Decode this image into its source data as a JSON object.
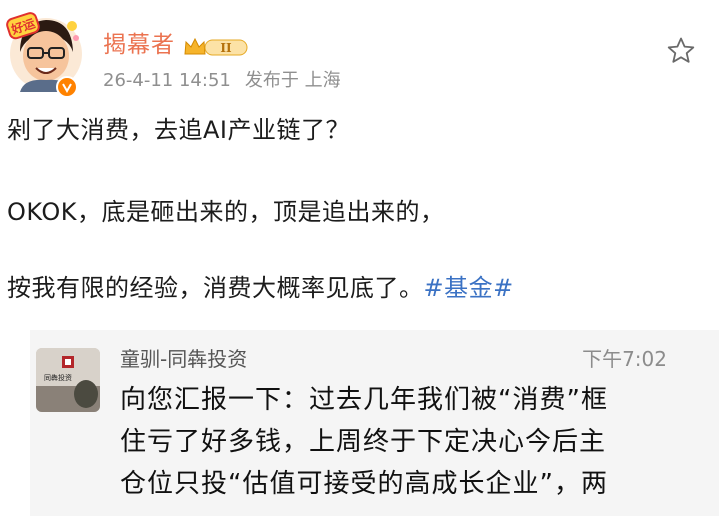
{
  "post": {
    "author": "揭幕者",
    "level_badge": "II",
    "timestamp": "26-4-11 14:51",
    "location": "发布于 上海",
    "lines": [
      "剁了大消费，去追AI产业链了？",
      "OKOK，底是砸出来的，顶是追出来的，",
      "按我有限的经验，消费大概率见底了。"
    ],
    "hashtag": "#基金#"
  },
  "quote": {
    "sender": "童驯-同犇投资",
    "time": "下午7:02",
    "avatar_text": "同犇投资",
    "message_lines": [
      "向您汇报一下：过去几年我们被“消费”框",
      "住亏了好多钱，上周终于下定决心今后主",
      "仓位只投“估值可接受的高成长企业”，两"
    ]
  },
  "colors": {
    "author": "#eb7350",
    "hashtag": "#3b72c4",
    "meta": "#8f8f8f",
    "verified": "#ff8200",
    "quote_bg": "#f5f5f5"
  },
  "icons": {
    "favorite": "star-outline-icon",
    "verified": "verified-v-icon",
    "level": "crown-level-icon"
  }
}
